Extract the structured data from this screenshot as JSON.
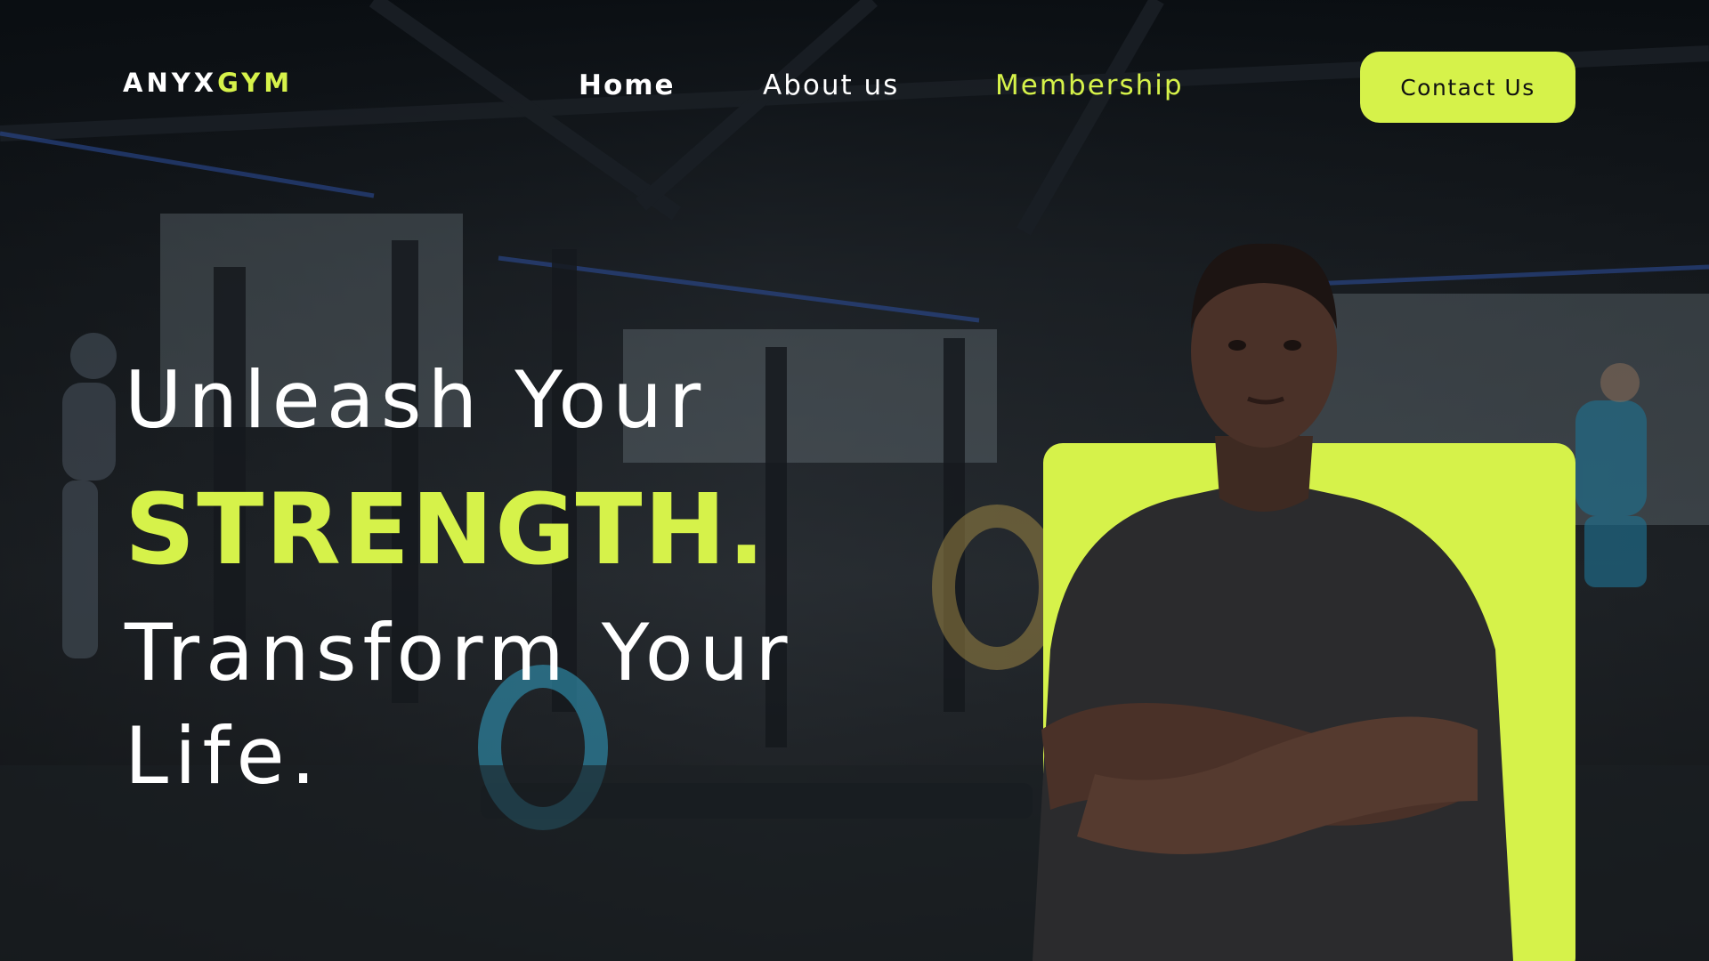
{
  "brand": {
    "logo_primary": "ANYX",
    "logo_accent": "GYM",
    "accent_color": "#d6f24a"
  },
  "nav": {
    "items": [
      {
        "label": "Home",
        "active": true
      },
      {
        "label": "About us"
      },
      {
        "label": "Membership",
        "highlighted": true
      }
    ],
    "contact_label": "Contact Us"
  },
  "hero": {
    "line1": "Unleash Your",
    "line2": "STRENGTH.",
    "line3": "Transform Your",
    "line4": "Life."
  },
  "images": {
    "background": "gym-interior-photo",
    "portrait": "man-arms-crossed-photo"
  }
}
